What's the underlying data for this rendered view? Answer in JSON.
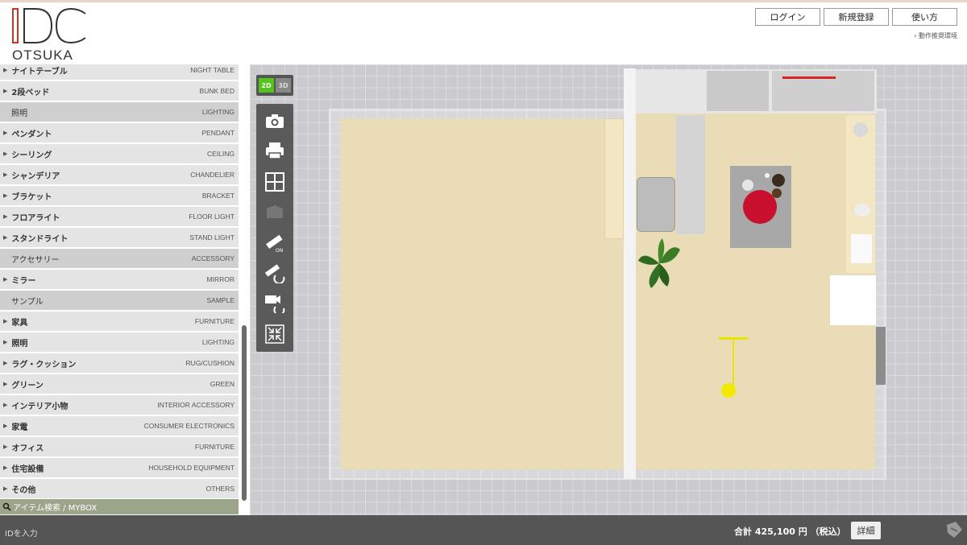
{
  "header": {
    "logo_mark": "IDC",
    "logo_sub": "OTSUKA",
    "login_label": "ログイン",
    "register_label": "新規登録",
    "howto_label": "使い方",
    "env_link": "› 動作推奨環境"
  },
  "sidebar": {
    "rows": [
      {
        "jp": "ナイトテーブル",
        "en": "NIGHT TABLE",
        "kind": "item"
      },
      {
        "jp": "2段ベッド",
        "en": "BUNK BED",
        "kind": "item"
      },
      {
        "jp": "照明",
        "en": "LIGHTING",
        "kind": "header"
      },
      {
        "jp": "ペンダント",
        "en": "PENDANT",
        "kind": "item"
      },
      {
        "jp": "シーリング",
        "en": "CEILING",
        "kind": "item"
      },
      {
        "jp": "シャンデリア",
        "en": "CHANDELIER",
        "kind": "item"
      },
      {
        "jp": "ブラケット",
        "en": "BRACKET",
        "kind": "item"
      },
      {
        "jp": "フロアライト",
        "en": "FLOOR LIGHT",
        "kind": "item"
      },
      {
        "jp": "スタンドライト",
        "en": "STAND LIGHT",
        "kind": "item"
      },
      {
        "jp": "アクセサリー",
        "en": "ACCESSORY",
        "kind": "header"
      },
      {
        "jp": "ミラー",
        "en": "MIRROR",
        "kind": "item"
      },
      {
        "jp": "サンプル",
        "en": "SAMPLE",
        "kind": "header"
      },
      {
        "jp": "家具",
        "en": "FURNITURE",
        "kind": "item"
      },
      {
        "jp": "照明",
        "en": "LIGHTING",
        "kind": "item"
      },
      {
        "jp": "ラグ・クッション",
        "en": "RUG/CUSHION",
        "kind": "item"
      },
      {
        "jp": "グリーン",
        "en": "GREEN",
        "kind": "item"
      },
      {
        "jp": "インテリア小物",
        "en": "INTERIOR ACCESSORY",
        "kind": "item"
      },
      {
        "jp": "家電",
        "en": "CONSUMER ELECTRONICS",
        "kind": "item"
      },
      {
        "jp": "オフィス",
        "en": "FURNITURE",
        "kind": "item"
      },
      {
        "jp": "住宅設備",
        "en": "HOUSEHOLD EQUIPMENT",
        "kind": "item"
      },
      {
        "jp": "その他",
        "en": "OTHERS",
        "kind": "item"
      }
    ],
    "search_label": "アイテム検索 / MYBOX"
  },
  "toolbar": {
    "mode_2d": "2D",
    "mode_3d": "3D",
    "active_mode": "2D",
    "tools": [
      "camera-icon",
      "print-icon",
      "grid-icon",
      "wall-icon",
      "measure-on-icon",
      "measure-rotate-icon",
      "camera-rotate-icon",
      "shrink-icon"
    ]
  },
  "footer": {
    "id_placeholder": "IDを入力",
    "total_label": "合計 425,100 円 （税込）",
    "detail_label": "詳細"
  },
  "colors": {
    "accent_green": "#52c41a",
    "floor": "#e9dcb6",
    "search_bar": "#9aa58a",
    "footer": "#555555"
  }
}
